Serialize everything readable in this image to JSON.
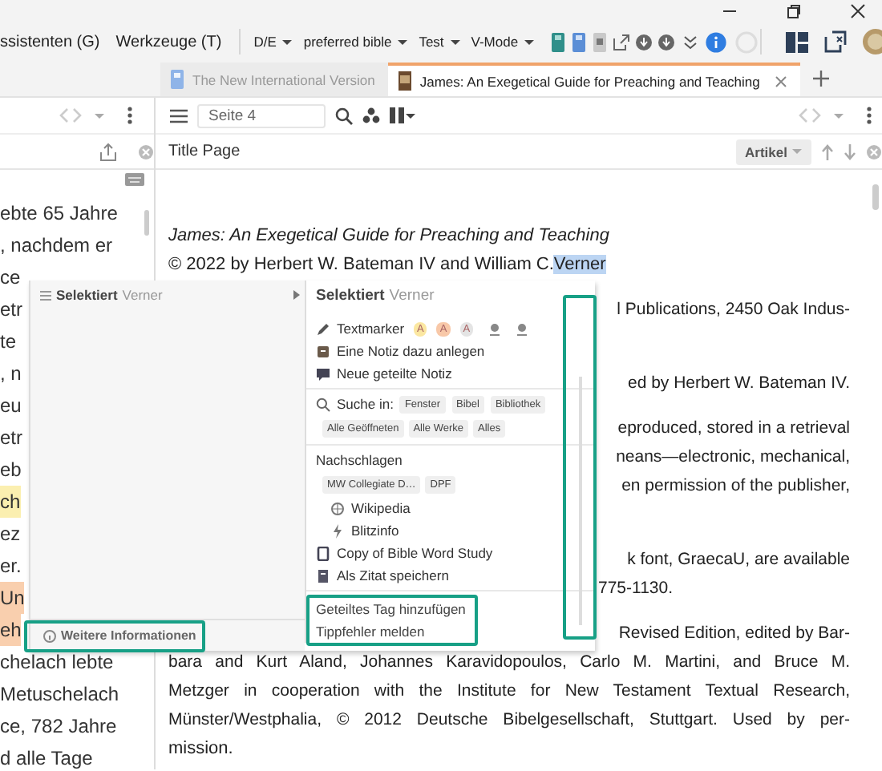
{
  "menu": [
    {
      "label": "ssistenten (G)"
    },
    {
      "label": "Werkzeuge (T)"
    }
  ],
  "dropdowns": [
    {
      "label": "D/E"
    },
    {
      "label": "preferred bible"
    },
    {
      "label": "Test"
    },
    {
      "label": "V-Mode"
    }
  ],
  "tabs": [
    {
      "label": "The New International Version",
      "selected": false
    },
    {
      "label": "James: An Exegetical Guide for Preaching and Teaching",
      "selected": true
    }
  ],
  "left_panel": {
    "lines": [
      {
        "text": "ebte 65 Jahre"
      },
      {
        "text": ", nachdem er"
      },
      {
        "text": "ce"
      },
      {
        "text": "etr"
      },
      {
        "text": "te"
      },
      {
        "text": ", n"
      },
      {
        "text": "eu"
      },
      {
        "text": "etr"
      },
      {
        "text": "eb"
      },
      {
        "text": "ch",
        "color": "#fbefb0"
      },
      {
        "text": "ez"
      },
      {
        "text": "er."
      },
      {
        "text": "Un",
        "color": "#f9cfae"
      },
      {
        "text": "eh",
        "color": "#f9cfae"
      },
      {
        "text": "chelach lebte"
      },
      {
        "text": "Metuschelach"
      },
      {
        "text": "ce, 782 Jahre"
      },
      {
        "text": "d alle Tage"
      }
    ]
  },
  "reader": {
    "page_field": {
      "value": "Seite 4"
    },
    "section_title": "Title Page",
    "article_button": "Artikel",
    "paragraphs": [
      {
        "continues": false,
        "lines": [
          {
            "kind": "italic",
            "text": "James: An Exegetical Guide for Preaching and Teaching"
          },
          {
            "kind": "copyright",
            "text": "© 2022 by Herbert W. Bateman IV and William C.",
            "selection": "Verner"
          }
        ]
      },
      {
        "continues": true,
        "lines": [
          {
            "kind": "fragment",
            "text": "l Publications, 2450 Oak Indus-"
          }
        ]
      },
      {
        "continues": false,
        "lines": [
          {
            "kind": "fragment",
            "text": "ed by Herbert W. Bateman IV."
          }
        ]
      },
      {
        "continues": true,
        "lines": [
          {
            "kind": "fragment",
            "text": "eproduced, stored in a retrieval"
          },
          {
            "kind": "fragment",
            "text": "neans—electronic, mechanical,"
          },
          {
            "kind": "fragment",
            "text": "en permission of the publisher,"
          }
        ]
      },
      {
        "continues": false,
        "lines": [
          {
            "kind": "fragment",
            "text": "k font, GraecaU, are available"
          },
          {
            "kind": "fragment-end",
            "text": "775-1130."
          }
        ]
      },
      {
        "continues": false,
        "lines": [
          {
            "kind": "fragment",
            "text": "Revised Edition, edited by Bar-"
          },
          {
            "kind": "full",
            "text": "bara and Kurt Aland, Johannes Karavidopoulos, Carlo M. Martini, and Bruce M."
          },
          {
            "kind": "full",
            "text": "Metzger in cooperation with the Institute for New Testament Textual Research,"
          },
          {
            "kind": "full",
            "text": "Münster/Westphalia, © 2012 Deutsche Bibelgesellschaft, Stuttgart. Used by per-"
          },
          {
            "kind": "end",
            "text": "mission."
          }
        ]
      }
    ]
  },
  "popup": {
    "left": {
      "heading": "Selektiert",
      "selection": "Verner",
      "footer": "Weitere Informationen",
      "footer_framed": true
    },
    "right": {
      "heading": "Selektiert",
      "selection": "Verner",
      "scrollbar_framed": true,
      "sections": [
        {
          "framed": false,
          "items": [
            {
              "kind": "highlighter",
              "label": "Textmarker",
              "chips": [
                {
                  "text": "A",
                  "color": "#fbe7a1"
                },
                {
                  "text": "A",
                  "color": "#f8c8a8"
                },
                {
                  "text": "A",
                  "color": "#e4e4e4"
                }
              ]
            },
            {
              "kind": "action",
              "label": "Eine Notiz dazu anlegen"
            },
            {
              "kind": "action",
              "label": "Neue geteilte Notiz"
            }
          ]
        },
        {
          "framed": false,
          "items": [
            {
              "kind": "search",
              "label": "Suche in:",
              "chips": [
                "Fenster",
                "Bibel",
                "Bibliothek"
              ]
            },
            {
              "kind": "chips",
              "chips": [
                "Alle Geöffneten",
                "Alle Werke",
                "Alles"
              ]
            }
          ]
        },
        {
          "framed": false,
          "items": [
            {
              "kind": "heading",
              "label": "Nachschlagen"
            },
            {
              "kind": "chips",
              "chips": [
                "MW Collegiate D…",
                "DPF"
              ]
            },
            {
              "kind": "sub-action",
              "label": "Wikipedia"
            },
            {
              "kind": "sub-action",
              "label": "Blitzinfo"
            },
            {
              "kind": "action",
              "label": "Copy of Bible Word Study"
            },
            {
              "kind": "action",
              "label": "Als Zitat speichern"
            }
          ]
        },
        {
          "framed": true,
          "items": [
            {
              "kind": "plain",
              "label": "Geteiltes Tag hinzufügen"
            },
            {
              "kind": "plain",
              "label": "Tippfehler melden"
            }
          ]
        }
      ]
    }
  }
}
